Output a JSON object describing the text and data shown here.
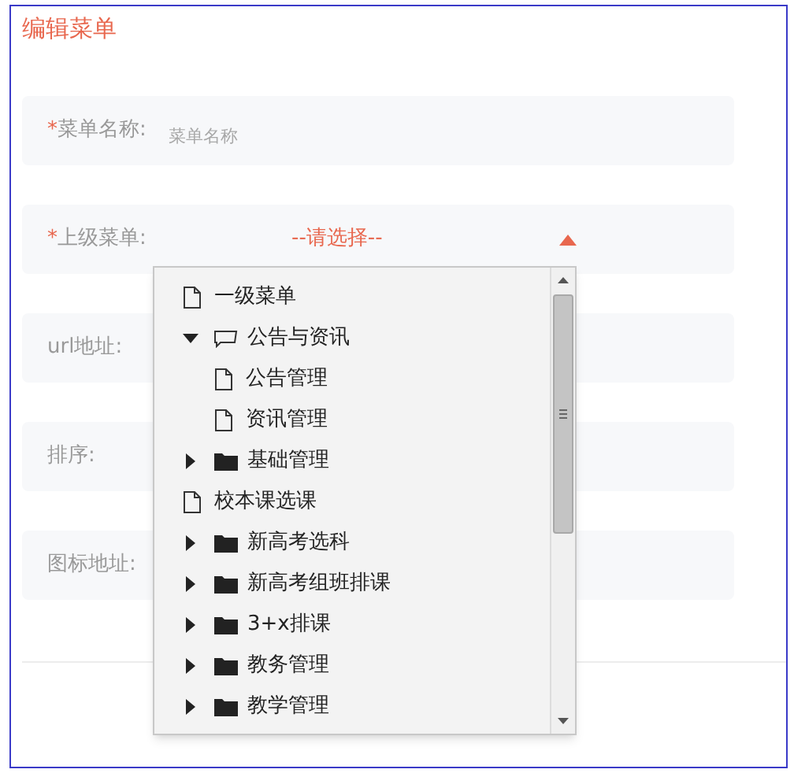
{
  "title": "编辑菜单",
  "fields": [
    {
      "label": "菜单名称:",
      "required": true,
      "kind": "input",
      "placeholder": "菜单名称"
    },
    {
      "label": "上级菜单:",
      "required": true,
      "kind": "select",
      "value": "--请选择--",
      "expanded": true
    },
    {
      "label": "url地址:",
      "required": false,
      "kind": "input"
    },
    {
      "label": "排序:",
      "required": false,
      "kind": "input"
    },
    {
      "label": "图标地址:",
      "required": false,
      "kind": "input"
    }
  ],
  "required_mark": "*",
  "tree": [
    {
      "label": "一级菜单",
      "kind": "file"
    },
    {
      "label": "公告与资讯",
      "kind": "folder",
      "expanded": true,
      "children": [
        {
          "label": "公告管理",
          "kind": "file"
        },
        {
          "label": "资讯管理",
          "kind": "file"
        }
      ]
    },
    {
      "label": "基础管理",
      "kind": "folder",
      "expanded": false
    },
    {
      "label": "校本课选课",
      "kind": "file"
    },
    {
      "label": "新高考选科",
      "kind": "folder",
      "expanded": false
    },
    {
      "label": "新高考组班排课",
      "kind": "folder",
      "expanded": false
    },
    {
      "label": "3+x排课",
      "kind": "folder",
      "expanded": false
    },
    {
      "label": "教务管理",
      "kind": "folder",
      "expanded": false
    },
    {
      "label": "教学管理",
      "kind": "folder",
      "expanded": false
    }
  ]
}
